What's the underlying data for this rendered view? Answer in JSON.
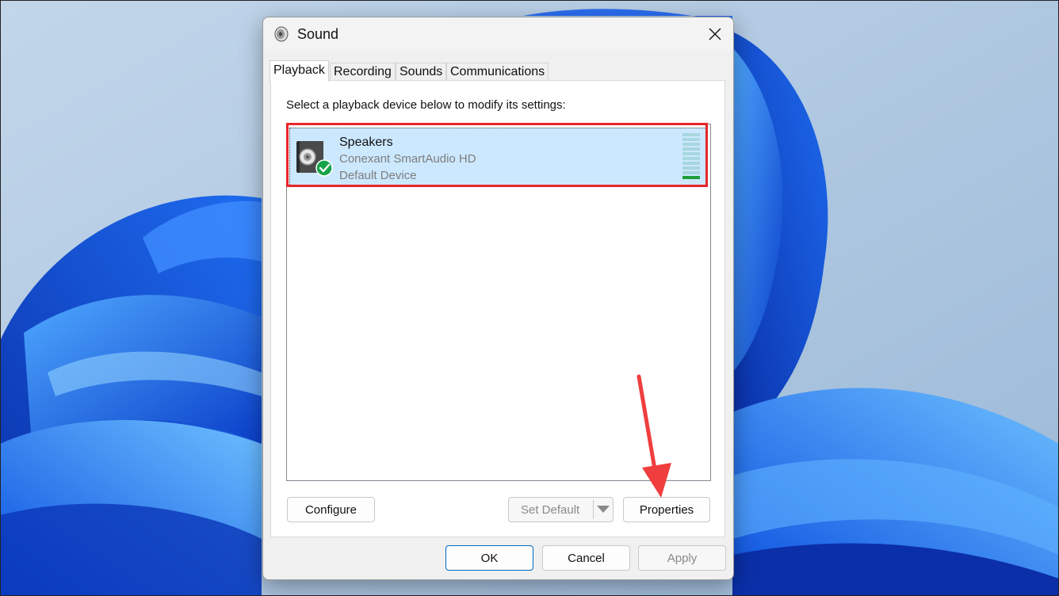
{
  "window": {
    "title": "Sound",
    "close_icon": "close-icon",
    "app_icon": "speaker-icon"
  },
  "tabs": [
    {
      "label": "Playback",
      "active": true
    },
    {
      "label": "Recording",
      "active": false
    },
    {
      "label": "Sounds",
      "active": false
    },
    {
      "label": "Communications",
      "active": false
    }
  ],
  "playback": {
    "instruction": "Select a playback device below to modify its settings:",
    "devices": [
      {
        "name": "Speakers",
        "driver": "Conexant SmartAudio HD",
        "status": "Default Device",
        "icon": "speaker-device-icon",
        "badge": "default-check-icon",
        "selected": true
      }
    ],
    "buttons": {
      "configure": "Configure",
      "set_default": "Set Default",
      "properties": "Properties"
    }
  },
  "footer": {
    "ok": "OK",
    "cancel": "Cancel",
    "apply": "Apply"
  },
  "colors": {
    "selection": "#cce8ff",
    "highlight_box": "#e8262a",
    "annotation_arrow": "#f03e3e",
    "check_badge": "#16a34a",
    "primary_border": "#0067c0"
  },
  "annotation": {
    "arrow_target": "properties-button"
  }
}
